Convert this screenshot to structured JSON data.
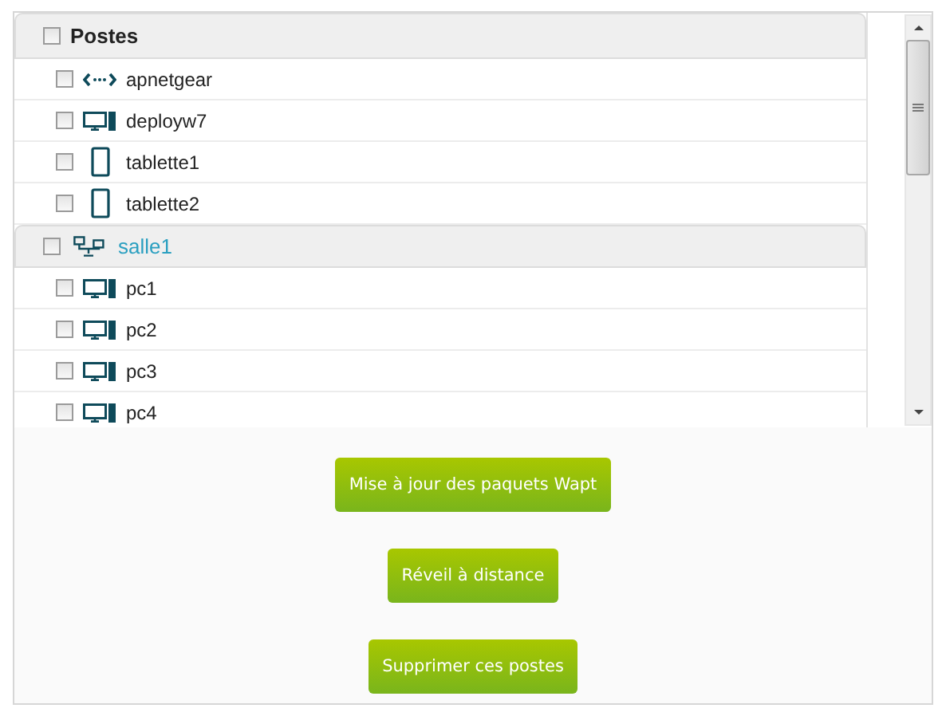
{
  "tree": {
    "groups": [
      {
        "label": "Postes",
        "kind": "root",
        "checked": false,
        "items": [
          {
            "name": "apnetgear",
            "kind": "network",
            "checked": false
          },
          {
            "name": "deployw7",
            "kind": "desktop",
            "checked": false
          },
          {
            "name": "tablette1",
            "kind": "tablet",
            "checked": false
          },
          {
            "name": "tablette2",
            "kind": "tablet",
            "checked": false
          }
        ]
      },
      {
        "label": "salle1",
        "kind": "lan",
        "checked": false,
        "items": [
          {
            "name": "pc1",
            "kind": "desktop",
            "checked": false
          },
          {
            "name": "pc2",
            "kind": "desktop",
            "checked": false
          },
          {
            "name": "pc3",
            "kind": "desktop",
            "checked": false
          },
          {
            "name": "pc4",
            "kind": "desktop",
            "checked": false
          }
        ]
      }
    ]
  },
  "buttons": [
    "Mise à jour des paquets Wapt",
    "Réveil à distance",
    "Supprimer ces postes"
  ]
}
